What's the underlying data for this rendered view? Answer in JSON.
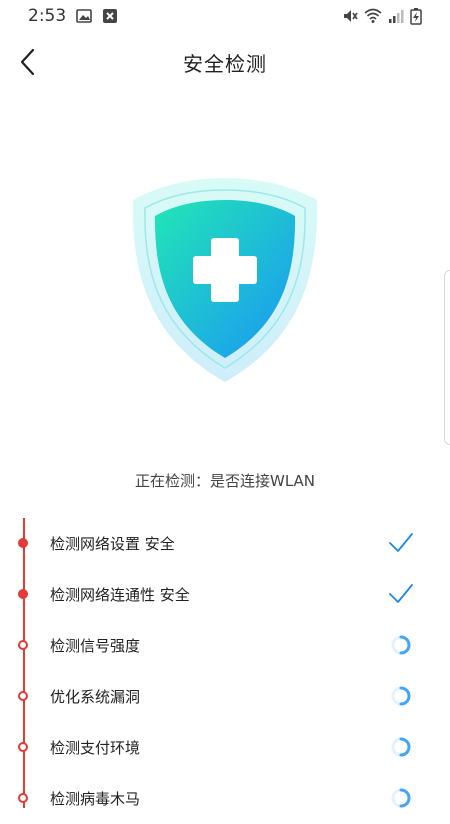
{
  "status_bar": {
    "time": "2:53",
    "left_icons": [
      "gallery-icon",
      "notification-x-icon"
    ],
    "right_icons": [
      "mute-icon",
      "wifi-icon",
      "signal-icon",
      "battery-charging-icon"
    ]
  },
  "header": {
    "back_icon": "chevron-left-icon",
    "title": "安全检测"
  },
  "shield": {
    "icon": "shield-plus-icon",
    "colors": {
      "top": "#23E6B8",
      "bottom": "#1D9CF5",
      "halo": "#BFF2F0"
    }
  },
  "scan_status": "正在检测：是否连接WLAN",
  "steps": [
    {
      "label": "检测网络设置 安全",
      "state": "done",
      "status_icon": "check-icon"
    },
    {
      "label": "检测网络连通性 安全",
      "state": "done",
      "status_icon": "check-icon"
    },
    {
      "label": "检测信号强度",
      "state": "pending",
      "status_icon": "loading-spinner-icon"
    },
    {
      "label": "优化系统漏洞",
      "state": "pending",
      "status_icon": "loading-spinner-icon"
    },
    {
      "label": "检测支付环境",
      "state": "pending",
      "status_icon": "loading-spinner-icon"
    },
    {
      "label": "检测病毒木马",
      "state": "pending",
      "status_icon": "loading-spinner-icon"
    }
  ],
  "colors": {
    "accent_red": "#E53935",
    "check_blue": "#1E88E5",
    "spinner_blue": "#42A5F5"
  }
}
